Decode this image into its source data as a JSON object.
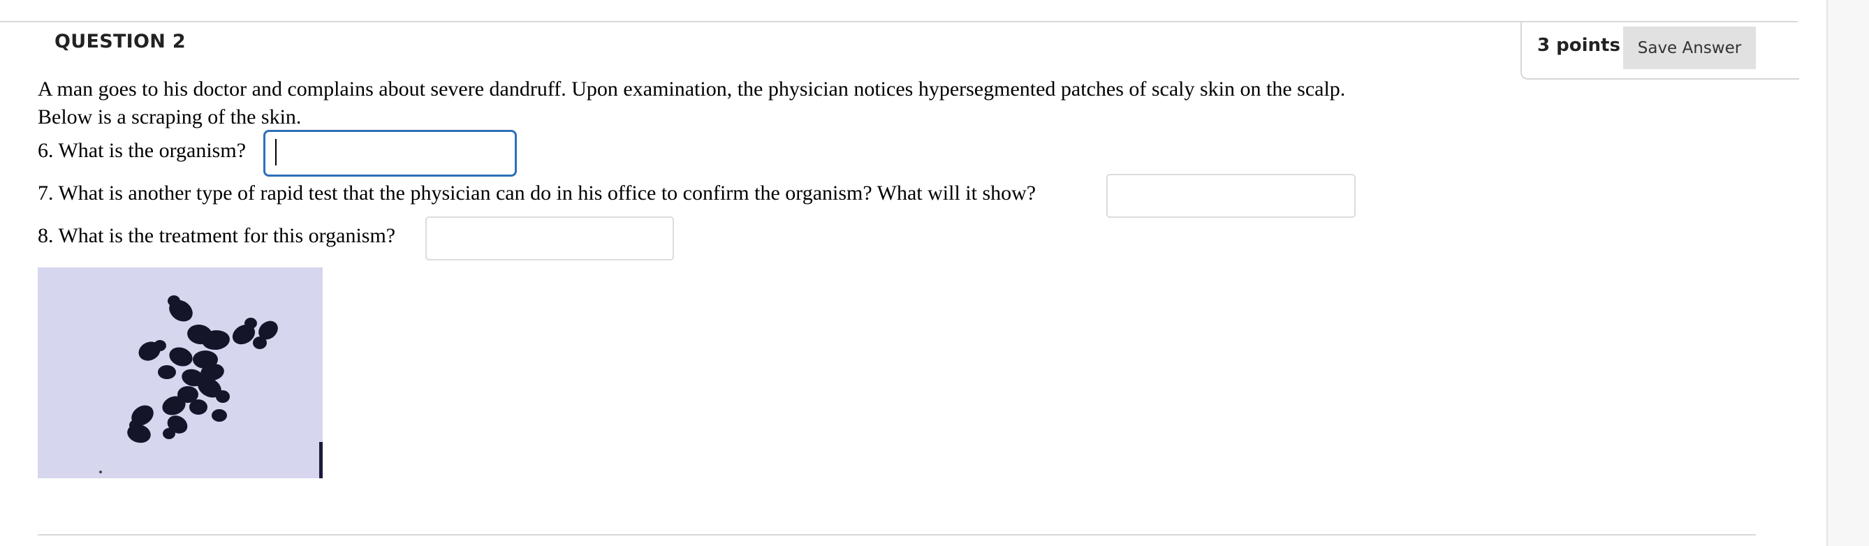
{
  "question": {
    "title": "QUESTION 2",
    "points": "3 points",
    "save_label": "Save Answer",
    "prompt": "A man goes to his doctor and complains about severe dandruff.  Upon examination, the physician notices hypersegmented patches of scaly skin on the scalp.  Below is a scraping of the skin.",
    "items": [
      {
        "label": "6. What is the organism?",
        "value": ""
      },
      {
        "label": "7. What is another type of rapid test that the physician can do in his office to confirm the organism? What will it show?",
        "value": ""
      },
      {
        "label": "8. What is the treatment for this organism?",
        "value": ""
      }
    ]
  },
  "colors": {
    "focus_border": "#2d6fb9",
    "micro_background": "#d6d6ef",
    "cell_stain": "#15152a"
  },
  "image": {
    "subject": "micrograph of dark-stained oval yeast cells in a cluster"
  }
}
